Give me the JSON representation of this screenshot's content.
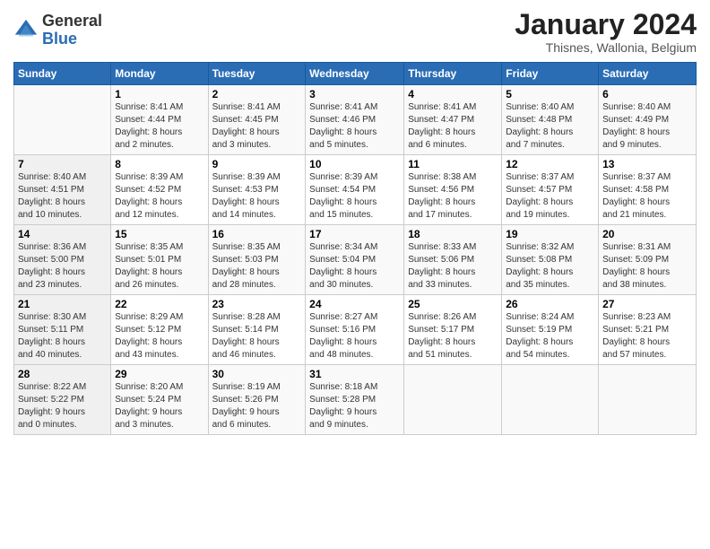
{
  "logo": {
    "general": "General",
    "blue": "Blue"
  },
  "title": "January 2024",
  "subtitle": "Thisnes, Wallonia, Belgium",
  "days_of_week": [
    "Sunday",
    "Monday",
    "Tuesday",
    "Wednesday",
    "Thursday",
    "Friday",
    "Saturday"
  ],
  "weeks": [
    [
      {
        "day": "",
        "info": ""
      },
      {
        "day": "1",
        "info": "Sunrise: 8:41 AM\nSunset: 4:44 PM\nDaylight: 8 hours\nand 2 minutes."
      },
      {
        "day": "2",
        "info": "Sunrise: 8:41 AM\nSunset: 4:45 PM\nDaylight: 8 hours\nand 3 minutes."
      },
      {
        "day": "3",
        "info": "Sunrise: 8:41 AM\nSunset: 4:46 PM\nDaylight: 8 hours\nand 5 minutes."
      },
      {
        "day": "4",
        "info": "Sunrise: 8:41 AM\nSunset: 4:47 PM\nDaylight: 8 hours\nand 6 minutes."
      },
      {
        "day": "5",
        "info": "Sunrise: 8:40 AM\nSunset: 4:48 PM\nDaylight: 8 hours\nand 7 minutes."
      },
      {
        "day": "6",
        "info": "Sunrise: 8:40 AM\nSunset: 4:49 PM\nDaylight: 8 hours\nand 9 minutes."
      }
    ],
    [
      {
        "day": "7",
        "info": "Sunrise: 8:40 AM\nSunset: 4:51 PM\nDaylight: 8 hours\nand 10 minutes."
      },
      {
        "day": "8",
        "info": "Sunrise: 8:39 AM\nSunset: 4:52 PM\nDaylight: 8 hours\nand 12 minutes."
      },
      {
        "day": "9",
        "info": "Sunrise: 8:39 AM\nSunset: 4:53 PM\nDaylight: 8 hours\nand 14 minutes."
      },
      {
        "day": "10",
        "info": "Sunrise: 8:39 AM\nSunset: 4:54 PM\nDaylight: 8 hours\nand 15 minutes."
      },
      {
        "day": "11",
        "info": "Sunrise: 8:38 AM\nSunset: 4:56 PM\nDaylight: 8 hours\nand 17 minutes."
      },
      {
        "day": "12",
        "info": "Sunrise: 8:37 AM\nSunset: 4:57 PM\nDaylight: 8 hours\nand 19 minutes."
      },
      {
        "day": "13",
        "info": "Sunrise: 8:37 AM\nSunset: 4:58 PM\nDaylight: 8 hours\nand 21 minutes."
      }
    ],
    [
      {
        "day": "14",
        "info": "Sunrise: 8:36 AM\nSunset: 5:00 PM\nDaylight: 8 hours\nand 23 minutes."
      },
      {
        "day": "15",
        "info": "Sunrise: 8:35 AM\nSunset: 5:01 PM\nDaylight: 8 hours\nand 26 minutes."
      },
      {
        "day": "16",
        "info": "Sunrise: 8:35 AM\nSunset: 5:03 PM\nDaylight: 8 hours\nand 28 minutes."
      },
      {
        "day": "17",
        "info": "Sunrise: 8:34 AM\nSunset: 5:04 PM\nDaylight: 8 hours\nand 30 minutes."
      },
      {
        "day": "18",
        "info": "Sunrise: 8:33 AM\nSunset: 5:06 PM\nDaylight: 8 hours\nand 33 minutes."
      },
      {
        "day": "19",
        "info": "Sunrise: 8:32 AM\nSunset: 5:08 PM\nDaylight: 8 hours\nand 35 minutes."
      },
      {
        "day": "20",
        "info": "Sunrise: 8:31 AM\nSunset: 5:09 PM\nDaylight: 8 hours\nand 38 minutes."
      }
    ],
    [
      {
        "day": "21",
        "info": "Sunrise: 8:30 AM\nSunset: 5:11 PM\nDaylight: 8 hours\nand 40 minutes."
      },
      {
        "day": "22",
        "info": "Sunrise: 8:29 AM\nSunset: 5:12 PM\nDaylight: 8 hours\nand 43 minutes."
      },
      {
        "day": "23",
        "info": "Sunrise: 8:28 AM\nSunset: 5:14 PM\nDaylight: 8 hours\nand 46 minutes."
      },
      {
        "day": "24",
        "info": "Sunrise: 8:27 AM\nSunset: 5:16 PM\nDaylight: 8 hours\nand 48 minutes."
      },
      {
        "day": "25",
        "info": "Sunrise: 8:26 AM\nSunset: 5:17 PM\nDaylight: 8 hours\nand 51 minutes."
      },
      {
        "day": "26",
        "info": "Sunrise: 8:24 AM\nSunset: 5:19 PM\nDaylight: 8 hours\nand 54 minutes."
      },
      {
        "day": "27",
        "info": "Sunrise: 8:23 AM\nSunset: 5:21 PM\nDaylight: 8 hours\nand 57 minutes."
      }
    ],
    [
      {
        "day": "28",
        "info": "Sunrise: 8:22 AM\nSunset: 5:22 PM\nDaylight: 9 hours\nand 0 minutes."
      },
      {
        "day": "29",
        "info": "Sunrise: 8:20 AM\nSunset: 5:24 PM\nDaylight: 9 hours\nand 3 minutes."
      },
      {
        "day": "30",
        "info": "Sunrise: 8:19 AM\nSunset: 5:26 PM\nDaylight: 9 hours\nand 6 minutes."
      },
      {
        "day": "31",
        "info": "Sunrise: 8:18 AM\nSunset: 5:28 PM\nDaylight: 9 hours\nand 9 minutes."
      },
      {
        "day": "",
        "info": ""
      },
      {
        "day": "",
        "info": ""
      },
      {
        "day": "",
        "info": ""
      }
    ]
  ]
}
